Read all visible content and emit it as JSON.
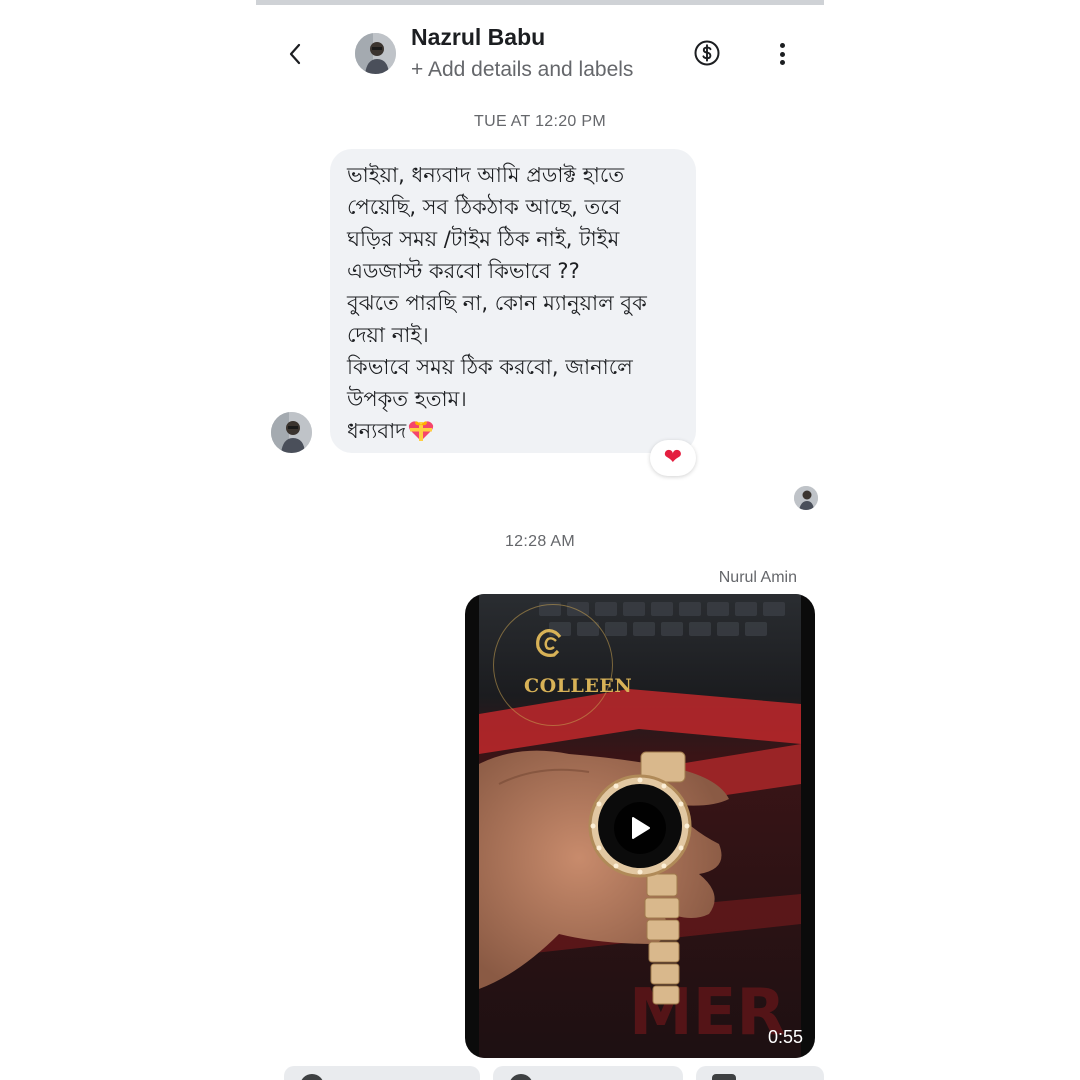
{
  "header": {
    "contact_name": "Nazrul Babu",
    "subtitle": "+ Add details and labels",
    "back_icon": "chevron-left-icon",
    "payment_icon": "dollar-circle-icon",
    "more_icon": "more-vertical-icon"
  },
  "conversation": {
    "timestamp_1": "TUE AT 12:20 PM",
    "incoming_message": {
      "lines": [
        "ভাইয়া, ধন্যবাদ আমি প্রডাক্ট হাতে",
        "পেয়েছি, সব ঠিকঠাক আছে, তবে",
        "ঘড়ির সময় /টাইম ঠিক নাই, টাইম",
        "এডজাস্ট করবো কিভাবে  ??",
        "বুঝতে পারছি না, কোন ম্যানুয়াল বুক",
        "দেয়া নাই।",
        "কিভাবে সময় ঠিক করবো, জানালে",
        "উপকৃত হতাম।",
        "ধন্যবাদ"
      ],
      "emoji": "gift-heart-emoji",
      "reaction": "❤"
    },
    "timestamp_2": "12:28 AM",
    "sender_name": "Nurul Amin",
    "video_message": {
      "brand_text": "COLLEEN",
      "duration": "0:55",
      "play_icon": "play-icon"
    }
  },
  "colors": {
    "bubble_incoming": "#f0f2f5",
    "text_primary": "#1c1e21",
    "text_secondary": "#65676b",
    "reaction_heart": "#e41e3f",
    "brand_gold": "#d8b257"
  }
}
